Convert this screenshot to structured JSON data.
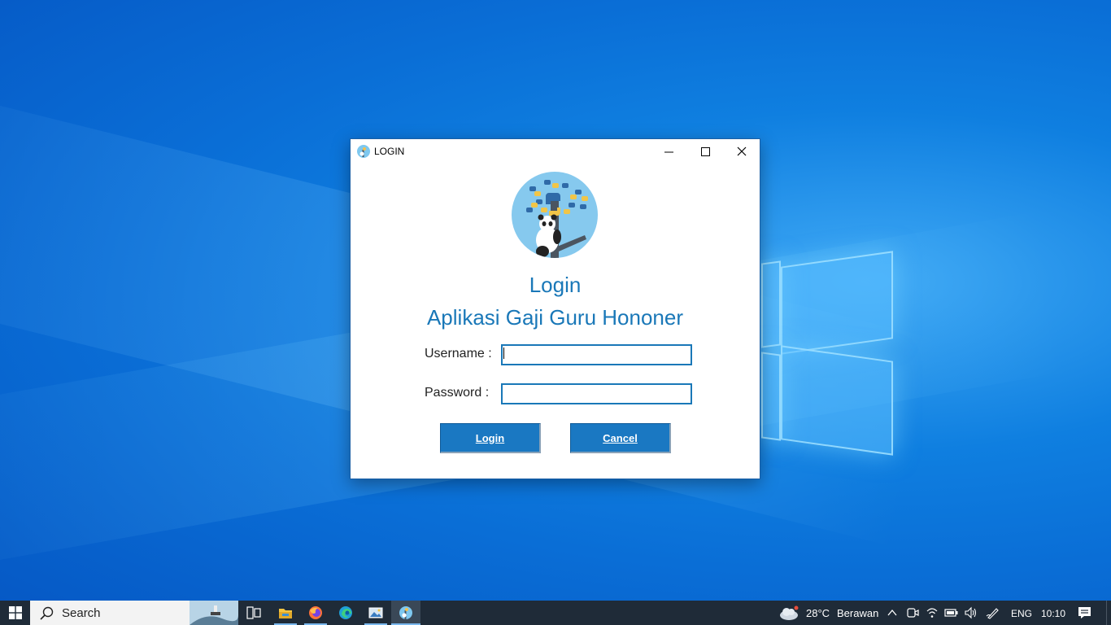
{
  "window": {
    "title": "LOGIN",
    "minimize_icon": "minimize-icon",
    "maximize_icon": "maximize-icon",
    "close_icon": "close-icon"
  },
  "form": {
    "heading": "Login",
    "subheading": "Aplikasi Gaji Guru Hononer",
    "username_label": "Username :",
    "username_value": "",
    "password_label": "Password :",
    "password_value": "",
    "login_button": "Login",
    "cancel_button": "Cancel",
    "accent_color": "#1a78b8"
  },
  "taskbar": {
    "search_placeholder": "Search",
    "weather": "28°C",
    "weather_desc": "Berawan",
    "language": "ENG",
    "time": "10:10",
    "apps": [
      "task-view-icon",
      "file-explorer-icon",
      "firefox-icon",
      "edge-icon",
      "photos-icon",
      "python-app-icon"
    ]
  }
}
